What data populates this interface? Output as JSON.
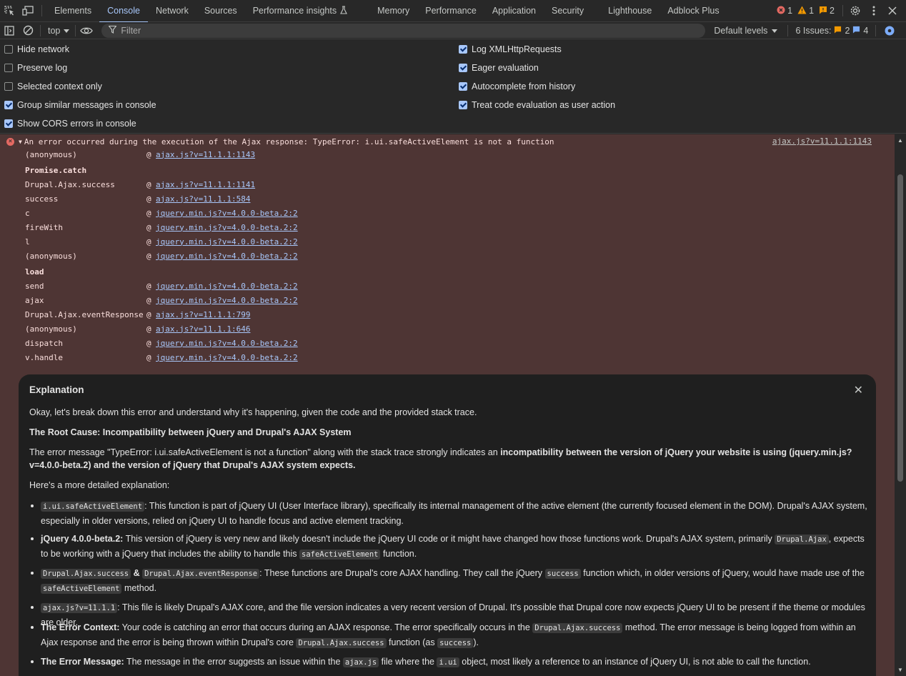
{
  "tabs": [
    {
      "label": "Elements"
    },
    {
      "label": "Console",
      "active": true
    },
    {
      "label": "Network"
    },
    {
      "label": "Sources"
    },
    {
      "label": "Performance insights"
    },
    {
      "label": "Memory"
    },
    {
      "label": "Performance"
    },
    {
      "label": "Application"
    },
    {
      "label": "Security"
    },
    {
      "label": "Lighthouse"
    },
    {
      "label": "Adblock Plus"
    }
  ],
  "counts": {
    "errors": "1",
    "warnings": "1",
    "issues": "2"
  },
  "filterbar": {
    "context": "top",
    "filter_placeholder": "Filter",
    "levels": "Default levels",
    "issues_label": "6 Issues:",
    "issues_a": "2",
    "issues_b": "4"
  },
  "settings": {
    "left": [
      {
        "label": "Hide network",
        "checked": false
      },
      {
        "label": "Preserve log",
        "checked": false
      },
      {
        "label": "Selected context only",
        "checked": false
      },
      {
        "label": "Group similar messages in console",
        "checked": true
      },
      {
        "label": "Show CORS errors in console",
        "checked": true
      }
    ],
    "right": [
      {
        "label": "Log XMLHttpRequests",
        "checked": true
      },
      {
        "label": "Eager evaluation",
        "checked": true
      },
      {
        "label": "Autocomplete from history",
        "checked": true
      },
      {
        "label": "Treat code evaluation as user action",
        "checked": true
      }
    ]
  },
  "error": {
    "message": "An error occurred during the execution of the Ajax response: TypeError: i.ui.safeActiveElement is not a function",
    "source": "ajax.js?v=11.1.1:1143",
    "stack": [
      {
        "fn": "(anonymous)",
        "loc": "ajax.js?v=11.1.1:1143"
      },
      {
        "group": "Promise.catch"
      },
      {
        "fn": "Drupal.Ajax.success",
        "loc": "ajax.js?v=11.1.1:1141"
      },
      {
        "fn": "success",
        "loc": "ajax.js?v=11.1.1:584"
      },
      {
        "fn": "c",
        "loc": "jquery.min.js?v=4.0.0-beta.2:2"
      },
      {
        "fn": "fireWith",
        "loc": "jquery.min.js?v=4.0.0-beta.2:2"
      },
      {
        "fn": "l",
        "loc": "jquery.min.js?v=4.0.0-beta.2:2"
      },
      {
        "fn": "(anonymous)",
        "loc": "jquery.min.js?v=4.0.0-beta.2:2"
      },
      {
        "group": "load"
      },
      {
        "fn": "send",
        "loc": "jquery.min.js?v=4.0.0-beta.2:2"
      },
      {
        "fn": "ajax",
        "loc": "jquery.min.js?v=4.0.0-beta.2:2"
      },
      {
        "fn": "Drupal.Ajax.eventResponse",
        "loc": "ajax.js?v=11.1.1:799"
      },
      {
        "fn": "(anonymous)",
        "loc": "ajax.js?v=11.1.1:646"
      },
      {
        "fn": "dispatch",
        "loc": "jquery.min.js?v=4.0.0-beta.2:2"
      },
      {
        "fn": "v.handle",
        "loc": "jquery.min.js?v=4.0.0-beta.2:2"
      }
    ]
  },
  "explanation": {
    "title": "Explanation",
    "intro": "Okay, let's break down this error and understand why it's happening, given the code and the provided stack trace.",
    "root_cause": "The Root Cause: Incompatibility between jQuery and Drupal's AJAX System",
    "para1_a": "The error message \"TypeError: i.ui.safeActiveElement is not a function\" along with the stack trace strongly indicates an ",
    "para1_b": "incompatibility between the version of jQuery your website is using (jquery.min.js?v=4.0.0-beta.2) and the version of jQuery that Drupal's AJAX system expects.",
    "detail_intro": "Here's a more detailed explanation:",
    "b1_code": "i.ui.safeActiveElement",
    "b1_text": ": This function is part of jQuery UI (User Interface library), specifically its internal management of the active element (the currently focused element in the DOM). Drupal's AJAX system, especially in older versions, relied on jQuery UI to handle focus and active element tracking.",
    "b2_bold": "jQuery 4.0.0-beta.2:",
    "b2_text1": " This version of jQuery is very new and likely doesn't include the jQuery UI code or it might have changed how those functions work. Drupal's AJAX system, primarily ",
    "b2_code1": "Drupal.Ajax",
    "b2_text2": ", expects to be working with a jQuery that includes the ability to handle this ",
    "b2_code2": "safeActiveElement",
    "b2_text3": " function.",
    "b3_code1": "Drupal.Ajax.success",
    "b3_amp": " & ",
    "b3_code2": "Drupal.Ajax.eventResponse",
    "b3_text1": ": These functions are Drupal's core AJAX handling. They call the jQuery ",
    "b3_code3": "success",
    "b3_text2": " function which, in older versions of jQuery, would have made use of the ",
    "b3_code4": "safeActiveElement",
    "b3_text3": " method.",
    "b4_code": "ajax.js?v=11.1.1",
    "b4_text": ": This file is likely Drupal's AJAX core, and the file version indicates a very recent version of Drupal. It's possible that Drupal core now expects jQuery UI to be present if the theme or modules are older.",
    "b5_bold": "The Error Context:",
    "b5_text1": " Your code is catching an error that occurs during an AJAX response. The error specifically occurs in the ",
    "b5_code1": "Drupal.Ajax.success",
    "b5_text2": " method. The error message is being logged from within an Ajax response and the error is being thrown within Drupal's core ",
    "b5_code2": "Drupal.Ajax.success",
    "b5_text3": " function (as ",
    "b5_code3": "success",
    "b5_text4": ").",
    "b6_bold": "The Error Message:",
    "b6_text1": " The message in the error suggests an issue within the ",
    "b6_code1": "ajax.js",
    "b6_text2": " file where the ",
    "b6_code2": "i.ui",
    "b6_text3": " object, most likely a reference to an instance of jQuery UI, is not able to call the function."
  }
}
